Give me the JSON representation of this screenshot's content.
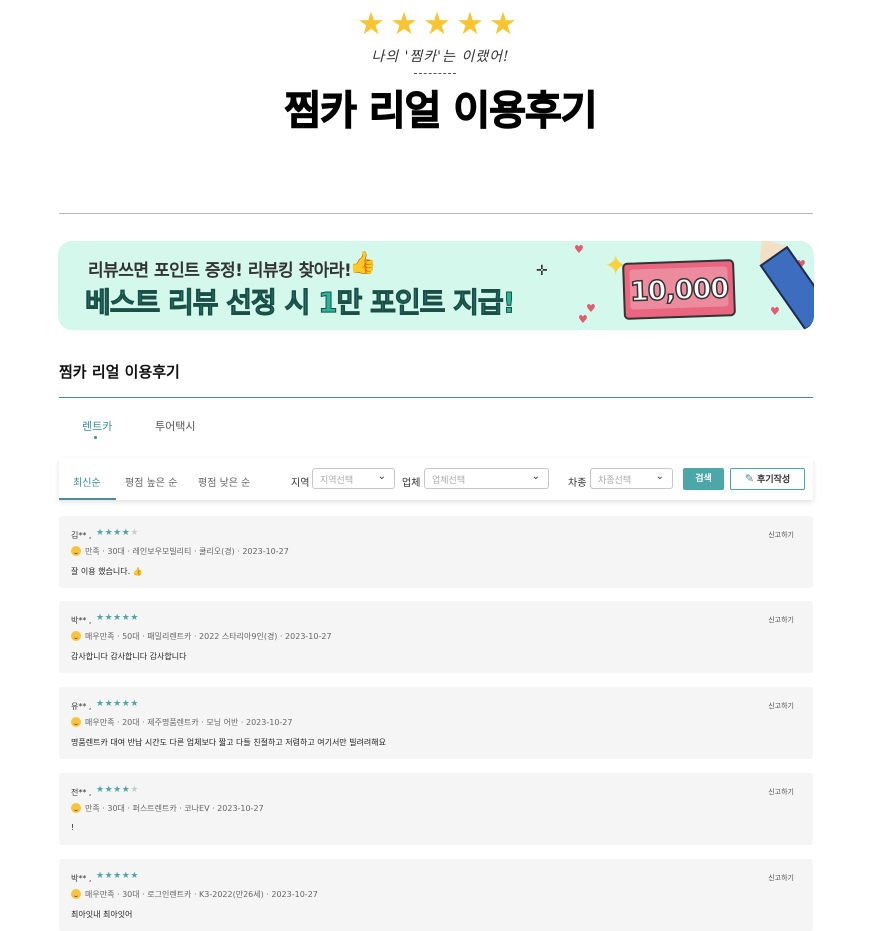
{
  "header": {
    "stars": [
      "★",
      "★",
      "★",
      "★",
      "★"
    ],
    "subtitle": "나의 '찜카'는 이랬어!",
    "title": "찜카 리얼 이용후기"
  },
  "banner": {
    "subtitle": "리뷰쓰면 포인트 증정! 리뷰킹 찾아라!",
    "headline": "베스트 리뷰 선정 시 1만 포인트 지급!",
    "amount": "10,000",
    "colors": {
      "background": "#d5f8ec",
      "headline": "#2ab59a",
      "card": "#e96580"
    }
  },
  "section": {
    "title": "찜카 리얼 이용후기"
  },
  "tabs": [
    {
      "label": "렌트카",
      "active": true
    },
    {
      "label": "투어택시",
      "active": false
    }
  ],
  "filters": {
    "sorts": [
      {
        "label": "최신순",
        "active": true
      },
      {
        "label": "평점 높은 순",
        "active": false
      },
      {
        "label": "평점 낮은 순",
        "active": false
      }
    ],
    "region": {
      "label": "지역",
      "placeholder": "지역선택"
    },
    "company": {
      "label": "업체",
      "placeholder": "업체선택"
    },
    "car": {
      "label": "차종",
      "placeholder": "차종선택"
    },
    "search_button": "검색",
    "write_button": "후기작성"
  },
  "reviews": [
    {
      "name": "김** ,",
      "rating": 4,
      "meta": "만족 · 30대 · 레인보우모빌리티 · 쿨리오(경) · 2023-10-27",
      "text": "잘 이용 했습니다. 👍",
      "report": "신고하기"
    },
    {
      "name": "박** ,",
      "rating": 5,
      "meta": "매우만족 · 50대 · 패밀리렌트카 · 2022 스타리아9인(경) · 2023-10-27",
      "text": "감사합니다 감사합니다 감사합니다",
      "report": "신고하기"
    },
    {
      "name": "유** ,",
      "rating": 5,
      "meta": "매우만족 · 20대 · 제주명품렌트카 · 모닝 어반 · 2023-10-27",
      "text": "명품렌트카 대여 반납 시간도 다른 업체보다 짧고 다들 친절하고 저렴하고 여기서만 빌려려해요",
      "report": "신고하기"
    },
    {
      "name": "전** ,",
      "rating": 4,
      "meta": "만족 · 30대 · 퍼스트렌트카 · 코나EV · 2023-10-27",
      "text": "!",
      "report": "신고하기"
    },
    {
      "name": "박** ,",
      "rating": 5,
      "meta": "매우만족 · 30대 · 로그인렌트카 · K3-2022(만26세) · 2023-10-27",
      "text": "최아잇내 최아잇어",
      "report": "신고하기"
    }
  ]
}
